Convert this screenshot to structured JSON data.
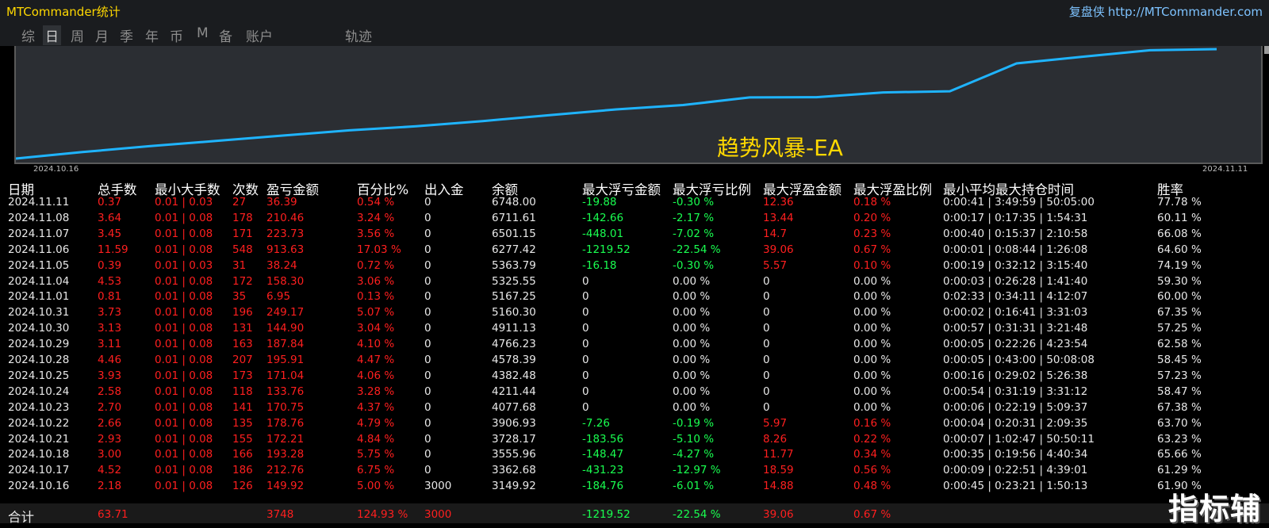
{
  "window": {
    "app_title": "MTCommander统计",
    "replay_label": "复盘侠",
    "site_url": "http://MTCommander.com"
  },
  "tabs": [
    {
      "label": "综",
      "active": false
    },
    {
      "label": "日",
      "active": true
    },
    {
      "label": "周",
      "active": false
    },
    {
      "label": "月",
      "active": false
    },
    {
      "label": "季",
      "active": false
    },
    {
      "label": "年",
      "active": false
    },
    {
      "label": "币",
      "active": false
    },
    {
      "label": "M",
      "active": false
    },
    {
      "label": "备",
      "active": false
    },
    {
      "label": "账户",
      "active": false
    },
    {
      "label": "轨迹",
      "active": false
    }
  ],
  "chart": {
    "title": "趋势风暴-EA",
    "x_start_label": "2024.10.16",
    "x_end_label": "2024.11.11",
    "line_color": "#1fb4ff"
  },
  "chart_data": {
    "type": "line",
    "title": "趋势风暴-EA",
    "x": [
      "2024.10.16",
      "2024.10.17",
      "2024.10.18",
      "2024.10.21",
      "2024.10.22",
      "2024.10.23",
      "2024.10.24",
      "2024.10.25",
      "2024.10.28",
      "2024.10.29",
      "2024.10.30",
      "2024.10.31",
      "2024.11.01",
      "2024.11.04",
      "2024.11.05",
      "2024.11.06",
      "2024.11.07",
      "2024.11.08",
      "2024.11.11"
    ],
    "series": [
      {
        "values": [
          3149.92,
          3362.68,
          3555.96,
          3728.17,
          3906.93,
          4077.68,
          4211.44,
          4382.48,
          4578.39,
          4766.23,
          4911.13,
          5160.3,
          5167.25,
          5325.55,
          5363.79,
          6277.42,
          6501.15,
          6711.61,
          6748.0
        ]
      }
    ]
  },
  "table": {
    "headers": [
      "日期",
      "总手数",
      "最小大手数",
      "次数",
      "盈亏金额",
      "百分比%",
      "出入金",
      "余额",
      "最大浮亏金额",
      "最大浮亏比例",
      "最大浮盈金额",
      "最大浮盈比例",
      "最小平均最大持仓时间",
      "胜率"
    ],
    "rows": [
      [
        "2024.11.11",
        "0.37",
        "0.01 | 0.03",
        "27",
        "36.39",
        "0.54 %",
        "0",
        "6748.00",
        "-19.88",
        "-0.30 %",
        "12.36",
        "0.18 %",
        "0:00:41 | 3:49:59 | 50:05:00",
        "77.78 %"
      ],
      [
        "2024.11.08",
        "3.64",
        "0.01 | 0.08",
        "178",
        "210.46",
        "3.24 %",
        "0",
        "6711.61",
        "-142.66",
        "-2.17 %",
        "13.44",
        "0.20 %",
        "0:00:17 | 0:17:35 | 1:54:31",
        "60.11 %"
      ],
      [
        "2024.11.07",
        "3.45",
        "0.01 | 0.08",
        "171",
        "223.73",
        "3.56 %",
        "0",
        "6501.15",
        "-448.01",
        "-7.02 %",
        "14.7",
        "0.23 %",
        "0:00:40 | 0:15:37 | 2:10:58",
        "66.08 %"
      ],
      [
        "2024.11.06",
        "11.59",
        "0.01 | 0.08",
        "548",
        "913.63",
        "17.03 %",
        "0",
        "6277.42",
        "-1219.52",
        "-22.54 %",
        "39.06",
        "0.67 %",
        "0:00:01 | 0:08:44 | 1:26:08",
        "64.60 %"
      ],
      [
        "2024.11.05",
        "0.39",
        "0.01 | 0.03",
        "31",
        "38.24",
        "0.72 %",
        "0",
        "5363.79",
        "-16.18",
        "-0.30 %",
        "5.57",
        "0.10 %",
        "0:00:19 | 0:32:12 | 3:15:40",
        "74.19 %"
      ],
      [
        "2024.11.04",
        "4.53",
        "0.01 | 0.08",
        "172",
        "158.30",
        "3.06 %",
        "0",
        "5325.55",
        "0",
        "0.00 %",
        "0",
        "0.00 %",
        "0:00:03 | 0:26:28 | 1:41:40",
        "59.30 %"
      ],
      [
        "2024.11.01",
        "0.81",
        "0.01 | 0.08",
        "35",
        "6.95",
        "0.13 %",
        "0",
        "5167.25",
        "0",
        "0.00 %",
        "0",
        "0.00 %",
        "0:02:33 | 0:34:11 | 4:12:07",
        "60.00 %"
      ],
      [
        "2024.10.31",
        "3.73",
        "0.01 | 0.08",
        "196",
        "249.17",
        "5.07 %",
        "0",
        "5160.30",
        "0",
        "0.00 %",
        "0",
        "0.00 %",
        "0:00:02 | 0:16:41 | 3:31:03",
        "67.35 %"
      ],
      [
        "2024.10.30",
        "3.13",
        "0.01 | 0.08",
        "131",
        "144.90",
        "3.04 %",
        "0",
        "4911.13",
        "0",
        "0.00 %",
        "0",
        "0.00 %",
        "0:00:57 | 0:31:31 | 3:21:48",
        "57.25 %"
      ],
      [
        "2024.10.29",
        "3.11",
        "0.01 | 0.08",
        "163",
        "187.84",
        "4.10 %",
        "0",
        "4766.23",
        "0",
        "0.00 %",
        "0",
        "0.00 %",
        "0:00:05 | 0:22:26 | 4:23:54",
        "62.58 %"
      ],
      [
        "2024.10.28",
        "4.46",
        "0.01 | 0.08",
        "207",
        "195.91",
        "4.47 %",
        "0",
        "4578.39",
        "0",
        "0.00 %",
        "0",
        "0.00 %",
        "0:00:05 | 0:43:00 | 50:08:08",
        "58.45 %"
      ],
      [
        "2024.10.25",
        "3.93",
        "0.01 | 0.08",
        "173",
        "171.04",
        "4.06 %",
        "0",
        "4382.48",
        "0",
        "0.00 %",
        "0",
        "0.00 %",
        "0:00:16 | 0:29:02 | 5:26:38",
        "57.23 %"
      ],
      [
        "2024.10.24",
        "2.58",
        "0.01 | 0.08",
        "118",
        "133.76",
        "3.28 %",
        "0",
        "4211.44",
        "0",
        "0.00 %",
        "0",
        "0.00 %",
        "0:00:54 | 0:31:19 | 3:31:12",
        "58.47 %"
      ],
      [
        "2024.10.23",
        "2.70",
        "0.01 | 0.08",
        "141",
        "170.75",
        "4.37 %",
        "0",
        "4077.68",
        "0",
        "0.00 %",
        "0",
        "0.00 %",
        "0:00:06 | 0:22:19 | 5:09:37",
        "67.38 %"
      ],
      [
        "2024.10.22",
        "2.66",
        "0.01 | 0.08",
        "135",
        "178.76",
        "4.79 %",
        "0",
        "3906.93",
        "-7.26",
        "-0.19 %",
        "5.97",
        "0.16 %",
        "0:00:04 | 0:20:31 | 2:09:35",
        "63.70 %"
      ],
      [
        "2024.10.21",
        "2.93",
        "0.01 | 0.08",
        "155",
        "172.21",
        "4.84 %",
        "0",
        "3728.17",
        "-183.56",
        "-5.10 %",
        "8.26",
        "0.22 %",
        "0:00:07 | 1:02:47 | 50:50:11",
        "63.23 %"
      ],
      [
        "2024.10.18",
        "3.00",
        "0.01 | 0.08",
        "166",
        "193.28",
        "5.75 %",
        "0",
        "3555.96",
        "-148.47",
        "-4.27 %",
        "11.77",
        "0.34 %",
        "0:00:35 | 0:19:56 | 4:40:34",
        "65.66 %"
      ],
      [
        "2024.10.17",
        "4.52",
        "0.01 | 0.08",
        "186",
        "212.76",
        "6.75 %",
        "0",
        "3362.68",
        "-431.23",
        "-12.97 %",
        "18.59",
        "0.56 %",
        "0:00:09 | 0:22:51 | 4:39:01",
        "61.29 %"
      ],
      [
        "2024.10.16",
        "2.18",
        "0.01 | 0.08",
        "126",
        "149.92",
        "5.00 %",
        "3000",
        "3149.92",
        "-184.76",
        "-6.01 %",
        "14.88",
        "0.48 %",
        "0:00:45 | 0:23:21 | 1:50:13",
        "61.90 %"
      ]
    ],
    "total": [
      "合计",
      "63.71",
      "",
      "",
      "3748",
      "124.93 %",
      "3000",
      "",
      "-1219.52",
      "-22.54 %",
      "39.06",
      "0.67 %",
      "",
      ""
    ]
  },
  "watermark": "指标辅",
  "colors": {
    "title_yellow": "#ffd800",
    "profit_red": "#ff1f1f",
    "loss_green": "#19ff50",
    "link_blue": "#7ec3ff",
    "chart_bg": "#2b2e33"
  }
}
